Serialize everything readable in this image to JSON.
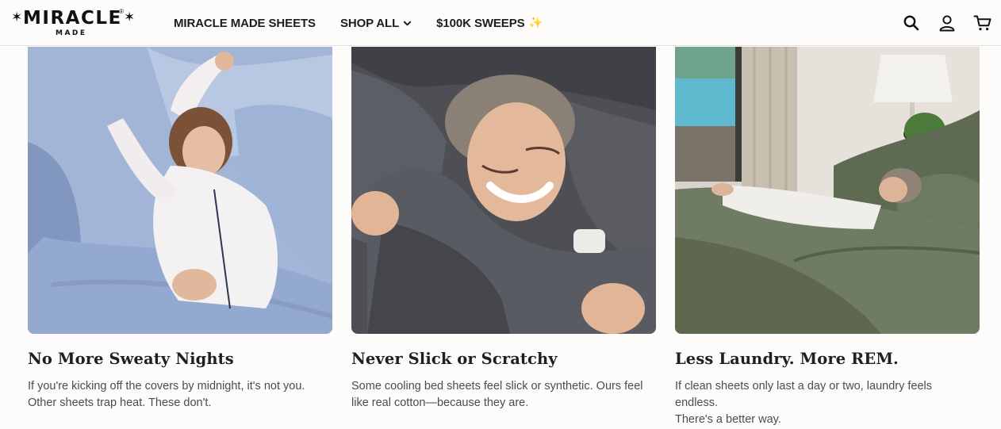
{
  "brand": {
    "name": "MIRACLE",
    "sub": "MADE",
    "star": "✶",
    "registered": "®"
  },
  "nav": {
    "items": [
      {
        "label": "MIRACLE MADE SHEETS"
      },
      {
        "label": "SHOP ALL"
      },
      {
        "label": "$100K SWEEPS"
      }
    ],
    "sparkle": "✨"
  },
  "icons": [
    "search-icon",
    "account-icon",
    "cart-icon"
  ],
  "colors": {
    "background": "#fdfcfa",
    "text": "#1f1f1f",
    "muted_text": "#4c4c4c",
    "sheet_blue": "#9db2d4",
    "sheet_gray": "#55575c",
    "sheet_green": "#6f7b63"
  },
  "features": [
    {
      "title": "No More Sweaty Nights",
      "text_line1": "If you're kicking off the covers by midnight, it's not you.",
      "text_line2": "Other sheets trap heat. These don't."
    },
    {
      "title": "Never Slick or Scratchy",
      "text_line1": "Some cooling bed sheets feel slick or synthetic. Ours feel",
      "text_line2": "like real cotton—because they are."
    },
    {
      "title": "Less Laundry. More REM.",
      "text_line1": "If clean sheets only last a day or two, laundry feels endless.",
      "text_line2": "There's a better way."
    }
  ]
}
